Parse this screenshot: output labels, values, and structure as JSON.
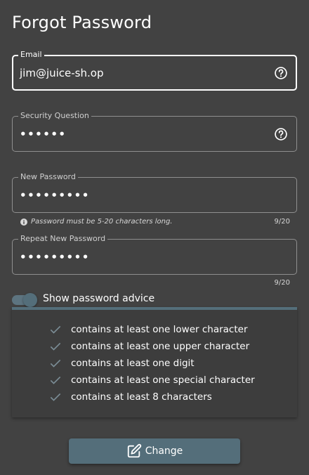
{
  "title": "Forgot Password",
  "colors": {
    "accent": "#546e7a",
    "background": "#424242",
    "panel": "#3d3d3d"
  },
  "fields": {
    "email": {
      "label": "Email",
      "value": "jim@juice-sh.op",
      "icon": "help-circle-icon"
    },
    "security": {
      "label": "Security Question",
      "value": "••••••",
      "icon": "help-circle-icon"
    },
    "new_password": {
      "label": "New Password",
      "value": "•••••••••",
      "hint": "Password must be 5-20 characters long.",
      "counter": "9/20"
    },
    "repeat_password": {
      "label": "Repeat New Password",
      "value": "•••••••••",
      "counter": "9/20"
    }
  },
  "advice": {
    "toggle_label": "Show password advice",
    "toggle_on": true,
    "items": [
      "contains at least one lower character",
      "contains at least one upper character",
      "contains at least one digit",
      "contains at least one special character",
      "contains at least 8 characters"
    ]
  },
  "change_button": {
    "label": "Change",
    "icon": "edit-icon"
  }
}
